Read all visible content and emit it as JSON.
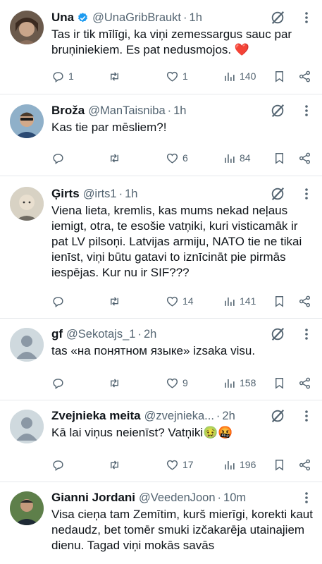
{
  "tweets": [
    {
      "name": "Una",
      "verified": true,
      "handle": "@UnaGribBraukt",
      "dot": "·",
      "time": "1h",
      "text": "Tas ir tik mīlīgi, ka viņi zemessargus sauc par bruņiniekiem. Es pat nedusmojos. ❤️",
      "replies": "1",
      "retweets": "",
      "likes": "1",
      "views": "140"
    },
    {
      "name": "Broža",
      "verified": false,
      "handle": "@ManTaisniba",
      "dot": "·",
      "time": "1h",
      "text": "Kas tie par mēsliem?!",
      "replies": "",
      "retweets": "",
      "likes": "6",
      "views": "84"
    },
    {
      "name": "Ģirts",
      "verified": false,
      "handle": "@irts1",
      "dot": "·",
      "time": "1h",
      "text": "Viena lieta, kremlis, kas mums nekad neļaus iemigt, otra, te esošie vatņiki, kuri visticamāk ir pat LV pilsoņi. Latvijas armiju, NATO tie ne tikai ienīst, viņi būtu gatavi to iznīcināt pie pirmās iespējas. Kur nu ir SIF???",
      "replies": "",
      "retweets": "",
      "likes": "14",
      "views": "141"
    },
    {
      "name": "gf",
      "verified": false,
      "handle": "@Sekotajs_1",
      "dot": "·",
      "time": "2h",
      "text": "tas «на понятном языке»  izsaka visu.",
      "replies": "",
      "retweets": "",
      "likes": "9",
      "views": "158"
    },
    {
      "name": "Zvejnieka meita",
      "verified": false,
      "handle": "@zvejnieka...",
      "dot": "·",
      "time": "2h",
      "text": "Kā lai viņus neienīst? Vatņiki🤢🤬",
      "replies": "",
      "retweets": "",
      "likes": "17",
      "views": "196"
    },
    {
      "name": "Gianni Jordani",
      "verified": false,
      "handle": "@VeedenJoon",
      "dot": "·",
      "time": "10m",
      "text": "Visa cieņa tam Zemītim, kurš mierīgi, korekti kaut nedaudz, bet tomēr smuki izčakarēja utainajiem dienu. Tagad viņi mokās savās",
      "replies": "",
      "retweets": "",
      "likes": "",
      "views": ""
    }
  ],
  "colors": {
    "text": "#0f1419",
    "secondary": "#536471",
    "verified": "#1d9bf0",
    "heart": "#f91880",
    "divider": "#e6e9ec"
  }
}
